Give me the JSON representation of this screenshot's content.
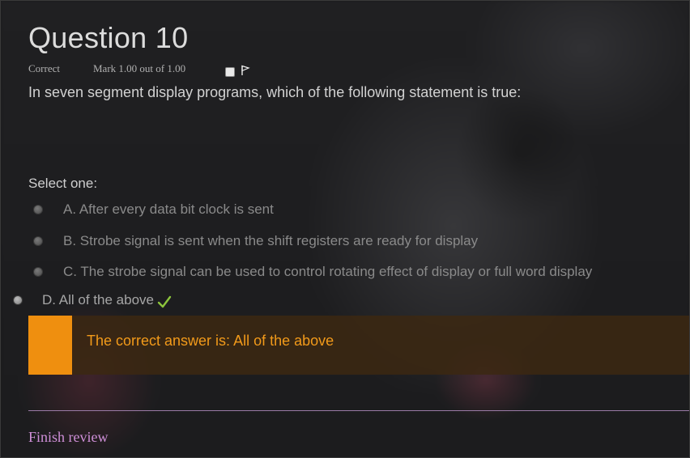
{
  "question": {
    "title": "Question 10",
    "state": "Correct",
    "mark": "Mark 1.00 out of 1.00",
    "text": "In seven segment display programs, which of the following statement is true:",
    "prompt": "Select one:"
  },
  "answers": [
    {
      "label": "A. After every data bit clock is sent"
    },
    {
      "label": "B. Strobe signal is sent when the shift registers are ready for display"
    },
    {
      "label": "C. The strobe signal can be used to control rotating effect of display or full word display"
    },
    {
      "label": "D. All of the above"
    }
  ],
  "feedback": {
    "text": "The correct answer is: All of the above",
    "accent_color": "#ef8f0f"
  },
  "footer": {
    "finish_label": "Finish review",
    "link_color": "#cf8fd8"
  },
  "icons": {
    "flag": "flag-icon",
    "correct": "check-icon"
  }
}
